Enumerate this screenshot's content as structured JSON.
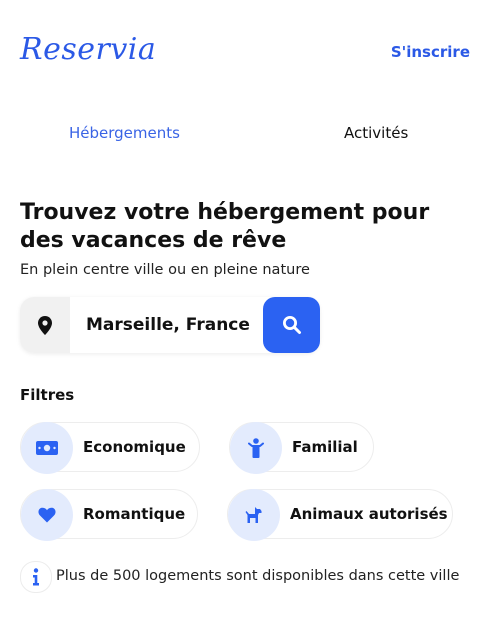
{
  "header": {
    "logo": "Reservia",
    "signup_label": "S'inscrire"
  },
  "tabs": [
    {
      "label": "Hébergements",
      "active": true
    },
    {
      "label": "Activités",
      "active": false
    }
  ],
  "hero": {
    "title": "Trouvez votre hébergement pour des vacances de rêve",
    "subtitle": "En plein centre ville ou en pleine nature"
  },
  "search": {
    "value": "Marseille, France",
    "icon": "location-pin-icon",
    "button_icon": "search-icon"
  },
  "filters": {
    "label": "Filtres",
    "items": [
      {
        "label": "Economique",
        "icon": "money-icon"
      },
      {
        "label": "Familial",
        "icon": "child-icon"
      },
      {
        "label": "Romantique",
        "icon": "heart-icon"
      },
      {
        "label": "Animaux autorisés",
        "icon": "dog-icon"
      }
    ]
  },
  "info": {
    "text": "Plus de 500 logements sont disponibles dans cette ville",
    "icon": "info-icon"
  },
  "colors": {
    "accent": "#2b62f2",
    "chip_icon_bg": "#e3ebfd"
  }
}
